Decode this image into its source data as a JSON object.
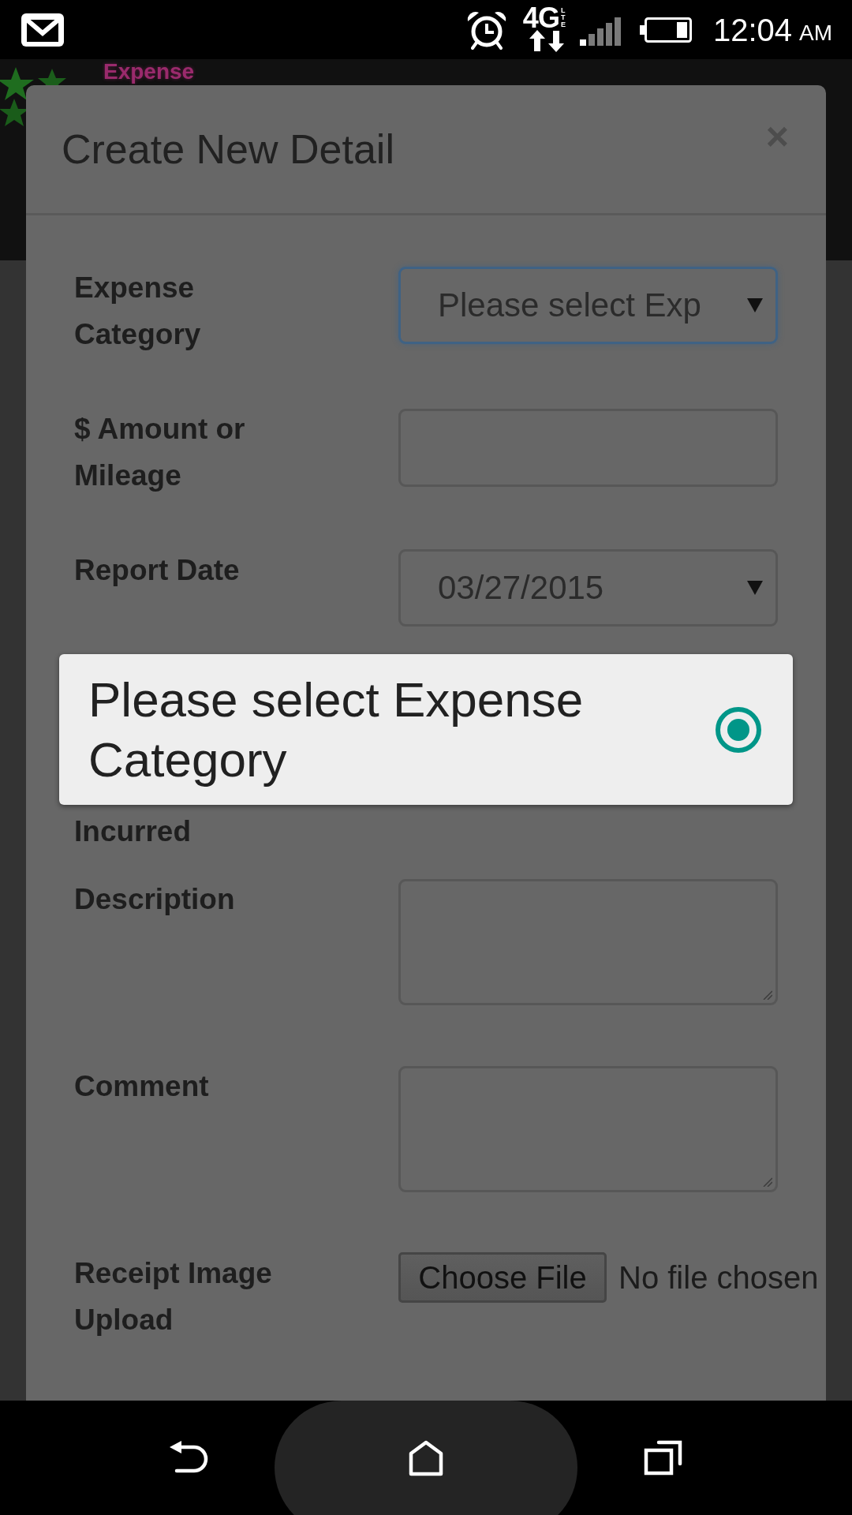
{
  "status_bar": {
    "network": "4G",
    "network_type": "LTE",
    "time": "12:04",
    "period": "AM"
  },
  "page_header": {
    "title": "Expense"
  },
  "modal": {
    "title": "Create New Detail",
    "close": "×",
    "fields": [
      {
        "kind": "select",
        "label": "Expense Category",
        "value": "Please select Exp",
        "focused": true
      },
      {
        "kind": "input",
        "label": "$ Amount or Mileage",
        "focused": false
      },
      {
        "kind": "select",
        "label": "Report Date",
        "value": "03/27/2015",
        "focused": false
      },
      {
        "kind": "label_only",
        "label": "Incurred"
      },
      {
        "kind": "textarea",
        "label": "Description",
        "focused": false
      },
      {
        "kind": "textarea",
        "label": "Comment",
        "focused": false
      },
      {
        "kind": "file",
        "label": "Receipt Image Upload",
        "button": "Choose File",
        "status": "No file chosen"
      }
    ]
  },
  "dropdown_popup": {
    "options": [
      {
        "label": "Please select Expense Category",
        "selected": true
      }
    ]
  }
}
